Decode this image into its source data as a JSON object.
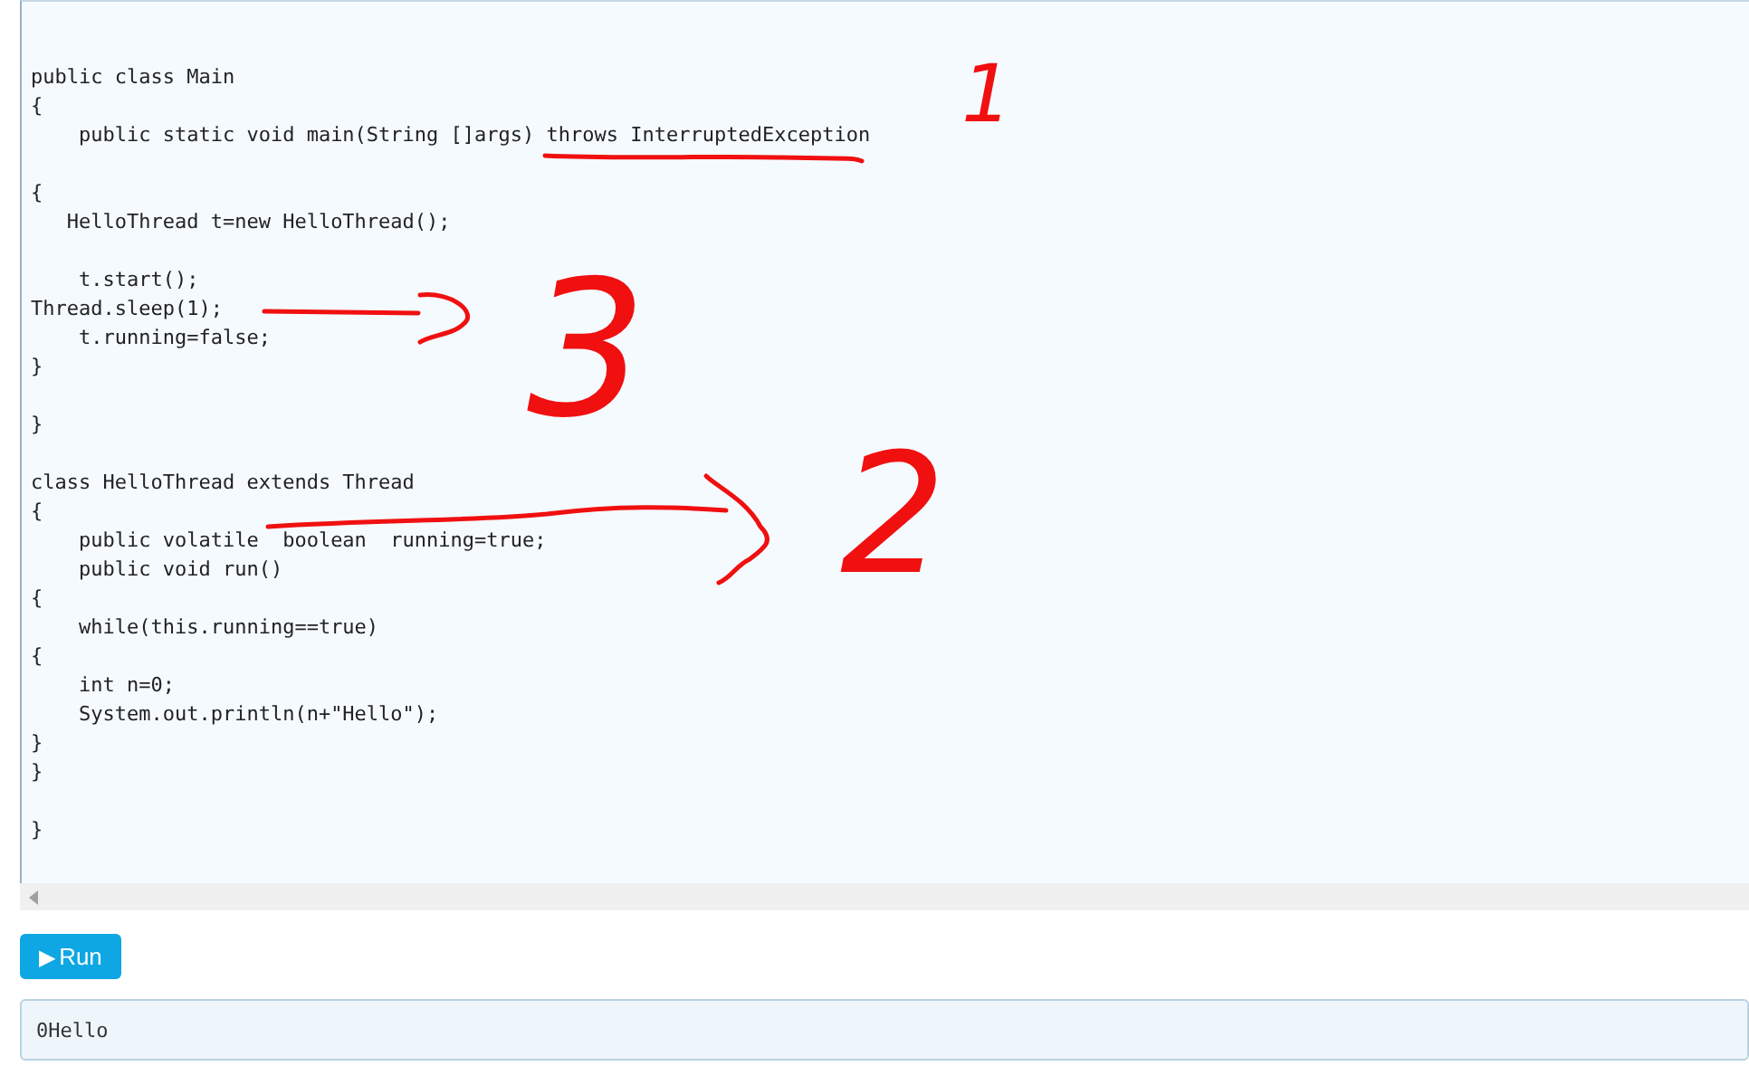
{
  "editor": {
    "blocks": [
      [
        "public class Main",
        "{",
        "    public static void main(String []args) throws InterruptedException"
      ],
      [
        "{",
        "   HelloThread t=new HelloThread();"
      ],
      [
        "    t.start();",
        "Thread.sleep(1);",
        "    t.running=false;",
        "}"
      ],
      [
        "}"
      ],
      [
        "class HelloThread extends Thread",
        "{",
        "    public volatile  boolean  running=true;",
        "    public void run()",
        "{",
        "    while(this.running==true)",
        "{",
        "    int n=0;",
        "    System.out.println(n+\"Hello\");",
        "}",
        "}"
      ],
      [
        "}"
      ]
    ]
  },
  "annotations": [
    {
      "text": "1"
    },
    {
      "text": "3"
    },
    {
      "text": "2"
    }
  ],
  "run_button": {
    "icon": "▶",
    "label": "Run"
  },
  "output": {
    "text": "0Hello"
  }
}
